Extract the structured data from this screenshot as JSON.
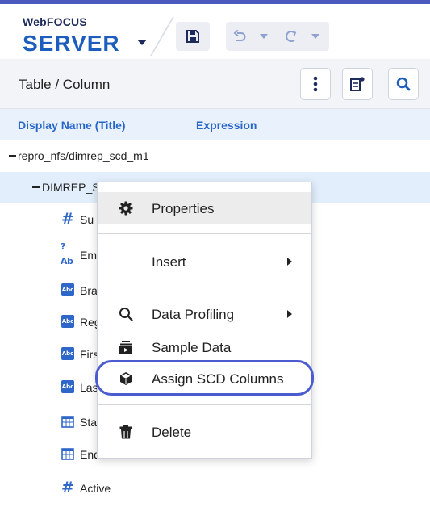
{
  "header": {
    "brand_top": "WebFOCUS",
    "brand_main": "SERVER"
  },
  "subbar": {
    "title": "Table / Column"
  },
  "columns": {
    "display_name": "Display Name (Title)",
    "expression": "Expression"
  },
  "tree": {
    "root": "repro_nfs/dimrep_scd_m1",
    "segment": "DIMREP_S",
    "fields": [
      {
        "label": "Su",
        "icon": "hash-icon"
      },
      {
        "label": "Em",
        "icon": "text-numeric-icon"
      },
      {
        "label": "Bra",
        "icon": "abc-icon"
      },
      {
        "label": "Reg",
        "icon": "abc-icon"
      },
      {
        "label": "Firs",
        "icon": "abc-icon"
      },
      {
        "label": "Las",
        "icon": "abc-icon"
      },
      {
        "label": "Sta",
        "icon": "calendar-icon"
      },
      {
        "label": "End",
        "icon": "calendar-icon"
      },
      {
        "label": "Active",
        "icon": "hash-icon"
      }
    ]
  },
  "context_menu": {
    "properties": "Properties",
    "insert": "Insert",
    "data_profiling": "Data Profiling",
    "sample_data": "Sample Data",
    "assign_scd": "Assign SCD Columns",
    "delete": "Delete"
  },
  "colors": {
    "accent": "#2966c9",
    "brand": "#1c5dbd",
    "highlight_ring": "#4b5bd0"
  }
}
